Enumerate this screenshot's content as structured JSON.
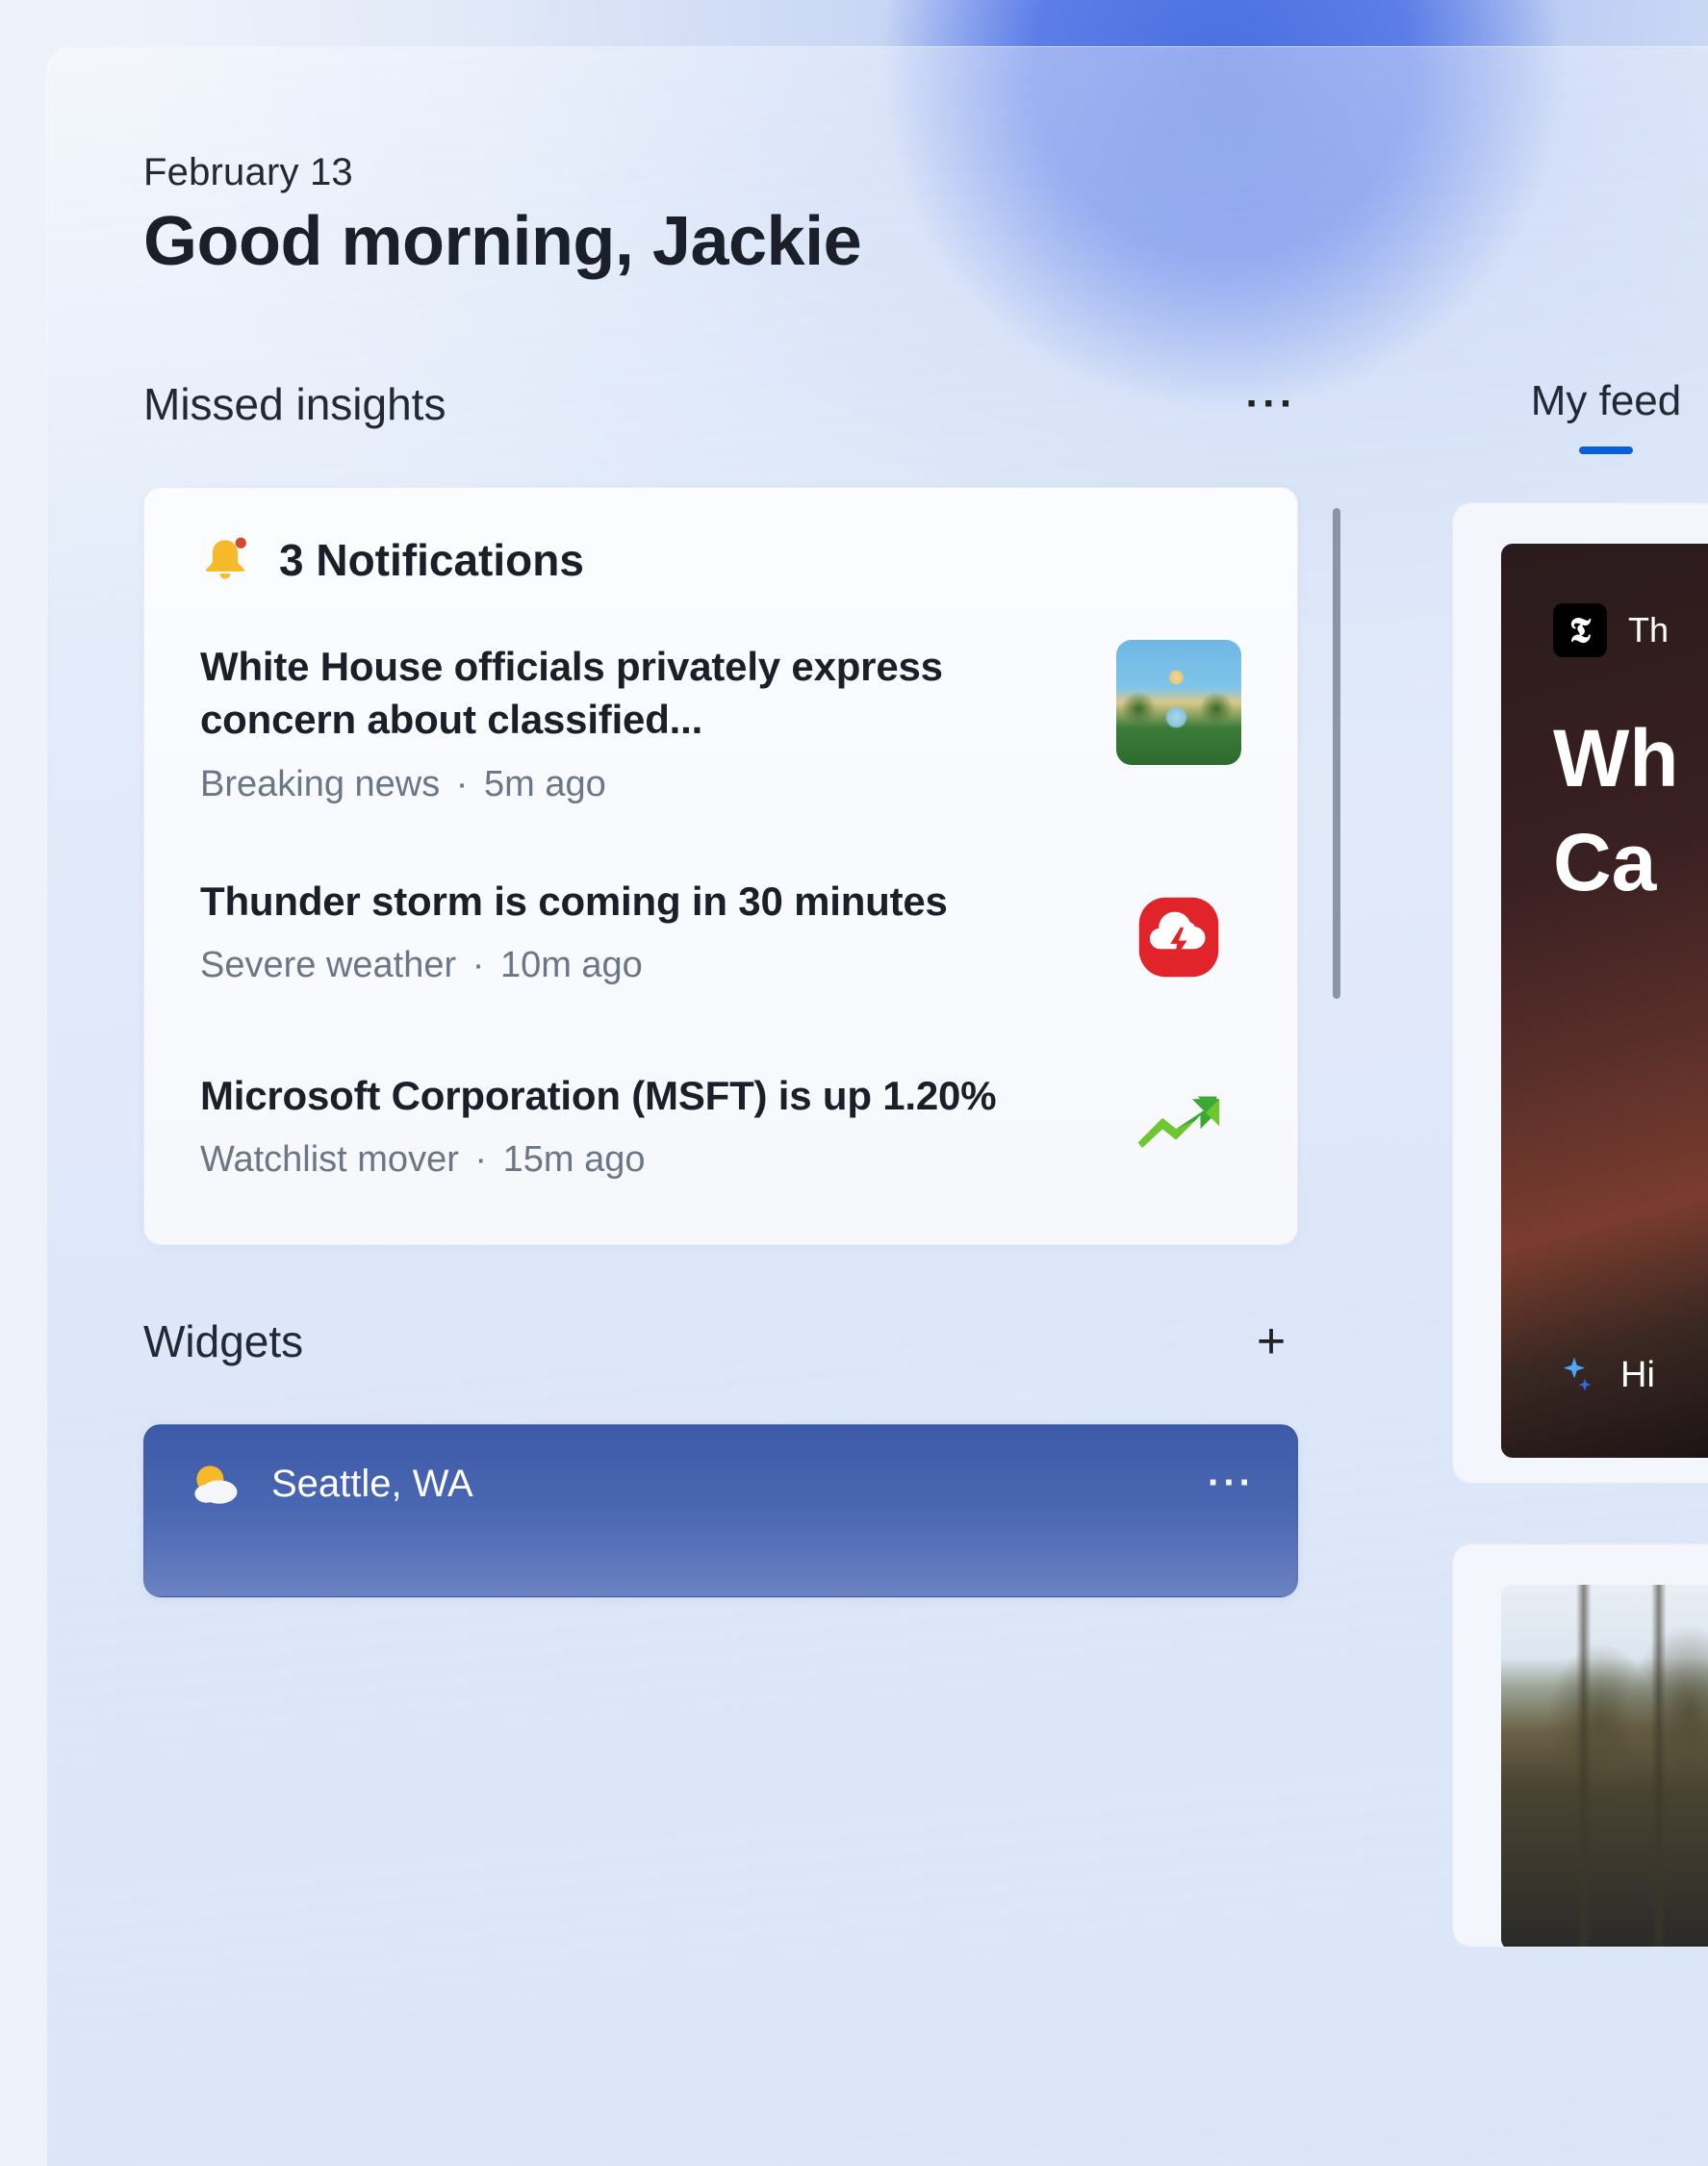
{
  "header": {
    "date": "February 13",
    "greeting": "Good morning, Jackie"
  },
  "insights": {
    "title": "Missed insights",
    "notifications_title": "3 Notifications",
    "items": [
      {
        "headline": "White House officials privately express concern about classified...",
        "category": "Breaking news",
        "time": "5m ago"
      },
      {
        "headline": "Thunder storm is coming in 30 minutes",
        "category": "Severe weather",
        "time": "10m ago"
      },
      {
        "headline": "Microsoft Corporation (MSFT) is up 1.20%",
        "category": "Watchlist mover",
        "time": "15m ago"
      }
    ]
  },
  "widgets": {
    "title": "Widgets",
    "weather": {
      "location": "Seattle, WA"
    }
  },
  "feed": {
    "tab_label": "My feed",
    "card1": {
      "source_short": "Th",
      "headline_partial": "Wh\nCa",
      "bottom_hint": "Hi"
    }
  },
  "glyphs": {
    "nyt": "𝕿"
  }
}
